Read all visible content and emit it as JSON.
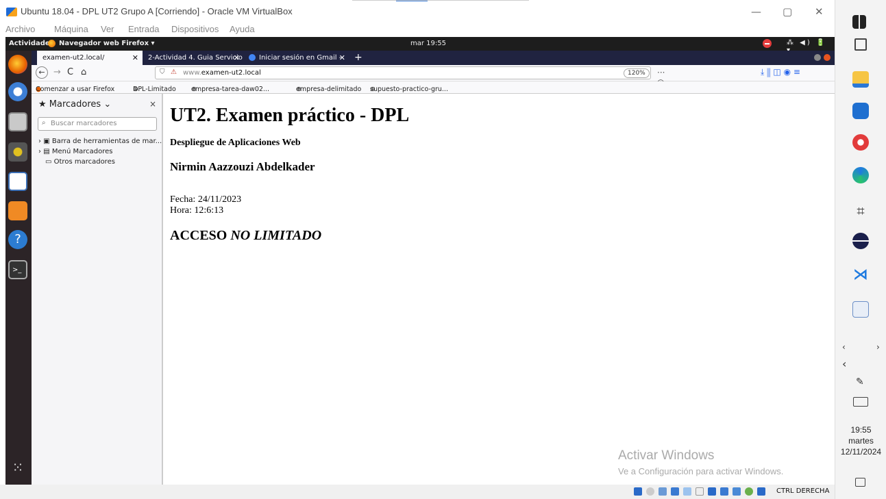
{
  "host": {
    "window_title": "Ubuntu 18.04 - DPL UT2 Grupo A [Corriendo] - Oracle VM VirtualBox",
    "menu": [
      "Archivo",
      "Máquina",
      "Ver",
      "Entrada",
      "Dispositivos",
      "Ayuda"
    ],
    "minimize": "—",
    "maximize": "▢",
    "close": "✕",
    "status_host_key": "CTRL DERECHA"
  },
  "gnome": {
    "activities": "Actividades",
    "app_menu": "Navegador web Firefox ▾",
    "clock": "mar 19:55",
    "system_tray": "⁂ ◀) 🔋 ▾"
  },
  "firefox": {
    "tabs": [
      {
        "label": "examen-ut2.local/",
        "close": "✕"
      },
      {
        "label": "2-Actividad 4. Guia Servicio",
        "close": "✕"
      },
      {
        "label": "Iniciar sesión en Gmail -",
        "close": "✕"
      }
    ],
    "new_tab": "+",
    "back": "←",
    "forward": "→",
    "reload": "C",
    "home": "⌂",
    "url_prefix": "www.",
    "url_domain": "examen-ut2.local",
    "zoom": "120%",
    "page_actions": "··· ◎ ☆",
    "toolbar_right": "⤓  ⫼  ◫  ◉  ≡",
    "bookmarks_bar": [
      "Comenzar a usar Firefox",
      "DPL-Limitado",
      "empresa-tarea-daw02...",
      "empresa-delimitado",
      "supuesto-practico-gru..."
    ]
  },
  "sidebar": {
    "title": "Marcadores ⌄",
    "close": "×",
    "search_placeholder": "Buscar marcadores",
    "items": [
      "Barra de herramientas de mar...",
      "Menú Marcadores",
      "Otros marcadores"
    ]
  },
  "page": {
    "heading": "UT2. Examen práctico - DPL",
    "subtitle": "Despliegue de Aplicaciones Web",
    "author": "Nirmin Aazzouzi Abdelkader",
    "date": "Fecha: 24/11/2023",
    "time": "Hora: 12:6:13",
    "access_prefix": "ACCESO ",
    "access_value": "NO LIMITADO"
  },
  "watermark": {
    "line1": "Activar Windows",
    "line2": "Ve a Configuración para activar Windows."
  },
  "windows_taskbar": {
    "time": "19:55",
    "day": "martes",
    "date": "12/11/2024"
  }
}
